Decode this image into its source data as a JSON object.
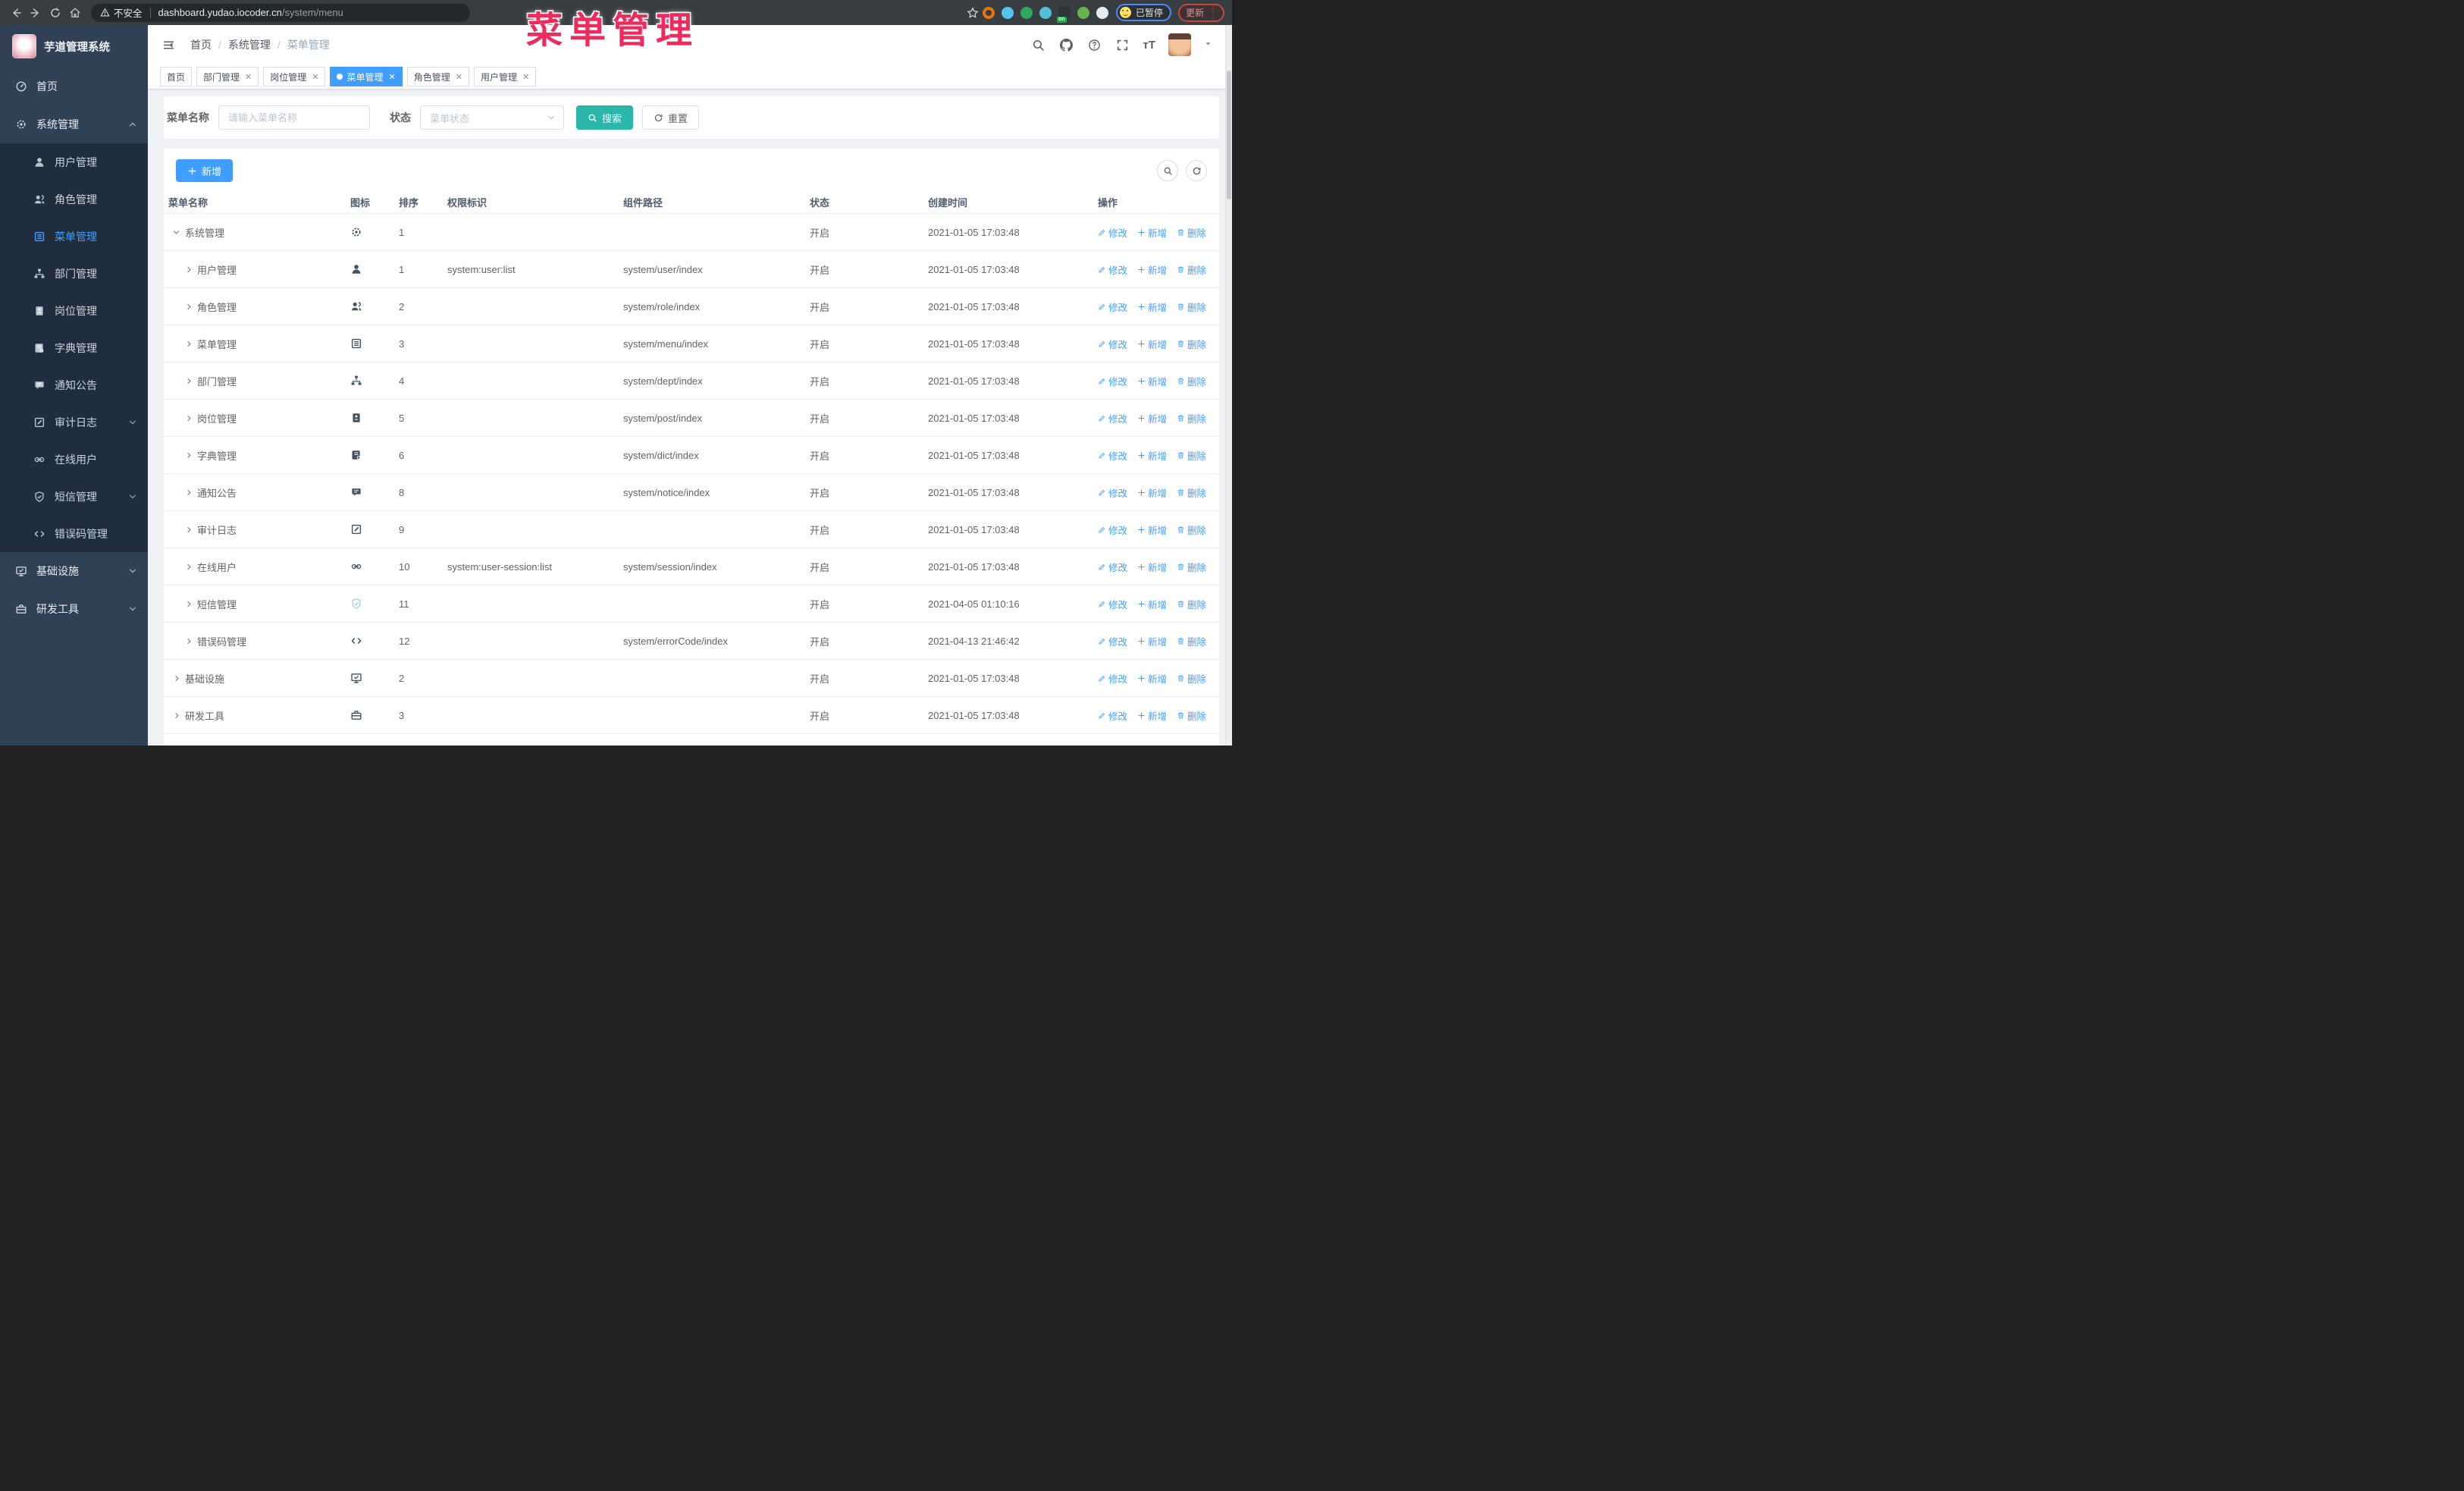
{
  "annotation": {
    "text": "菜单管理",
    "color": "#ee2b5d"
  },
  "browser": {
    "security_label": "不安全",
    "url_host": "dashboard.yudao.iocoder.cn",
    "url_path": "/system/menu",
    "paused_label": "已暂停",
    "update_label": "更新",
    "extension_icons": [
      {
        "name": "extension-icon-orange-ring",
        "color": "#e8710a",
        "style": "ring"
      },
      {
        "name": "extension-icon-blue-gem",
        "color": "#58c1f0",
        "style": "dot"
      },
      {
        "name": "extension-icon-green-check",
        "color": "#2fa75f",
        "style": "dot"
      },
      {
        "name": "extension-icon-teal-columns",
        "color": "#55bdd6",
        "style": "dot"
      },
      {
        "name": "extension-icon-dark-switch",
        "color": "#2f3438",
        "style": "square",
        "badge": "on"
      },
      {
        "name": "extension-icon-green-plant",
        "color": "#69b34b",
        "style": "dot"
      },
      {
        "name": "puzzle-icon",
        "color": "#e9eaed",
        "style": "dot"
      }
    ]
  },
  "sidebar": {
    "logo_title": "芋道管理系统",
    "items": [
      {
        "label": "首页",
        "icon": "dashboard-icon"
      },
      {
        "label": "系统管理",
        "icon": "gear-icon",
        "chevron": "up",
        "open": true,
        "children": [
          {
            "label": "用户管理",
            "icon": "user-icon"
          },
          {
            "label": "角色管理",
            "icon": "users-icon"
          },
          {
            "label": "菜单管理",
            "icon": "menu-icon",
            "active": true
          },
          {
            "label": "部门管理",
            "icon": "tree-icon"
          },
          {
            "label": "岗位管理",
            "icon": "badge-icon"
          },
          {
            "label": "字典管理",
            "icon": "book-icon"
          },
          {
            "label": "通知公告",
            "icon": "message-icon"
          },
          {
            "label": "审计日志",
            "icon": "edit-icon",
            "chevron": "down"
          },
          {
            "label": "在线用户",
            "icon": "link-icon"
          },
          {
            "label": "短信管理",
            "icon": "shield-icon",
            "chevron": "down"
          },
          {
            "label": "错误码管理",
            "icon": "code-icon"
          }
        ]
      },
      {
        "label": "基础设施",
        "icon": "monitor-icon",
        "chevron": "down"
      },
      {
        "label": "研发工具",
        "icon": "toolbox-icon",
        "chevron": "down"
      }
    ]
  },
  "header": {
    "breadcrumb": [
      "首页",
      "系统管理",
      "菜单管理"
    ]
  },
  "tabs": [
    {
      "label": "首页",
      "closable": false,
      "active": false
    },
    {
      "label": "部门管理",
      "closable": true,
      "active": false
    },
    {
      "label": "岗位管理",
      "closable": true,
      "active": false
    },
    {
      "label": "菜单管理",
      "closable": true,
      "active": true
    },
    {
      "label": "角色管理",
      "closable": true,
      "active": false
    },
    {
      "label": "用户管理",
      "closable": true,
      "active": false
    }
  ],
  "filter": {
    "name_label": "菜单名称",
    "name_placeholder": "请输入菜单名称",
    "name_value": "",
    "status_label": "状态",
    "status_placeholder": "菜单状态",
    "search_label": "搜索",
    "reset_label": "重置"
  },
  "toolbar": {
    "add_label": "新增"
  },
  "table": {
    "columns": [
      "菜单名称",
      "图标",
      "排序",
      "权限标识",
      "组件路径",
      "状态",
      "创建时间",
      "操作"
    ],
    "action_labels": {
      "edit": "修改",
      "add": "新增",
      "delete": "删除"
    },
    "rows": [
      {
        "name": "系统管理",
        "icon": "gear-icon",
        "level": 0,
        "expanded": true,
        "sort": "1",
        "perm": "",
        "path": "",
        "status": "开启",
        "time": "2021-01-05 17:03:48"
      },
      {
        "name": "用户管理",
        "icon": "user-icon",
        "level": 1,
        "expanded": false,
        "sort": "1",
        "perm": "system:user:list",
        "path": "system/user/index",
        "status": "开启",
        "time": "2021-01-05 17:03:48"
      },
      {
        "name": "角色管理",
        "icon": "users-icon",
        "level": 1,
        "expanded": false,
        "sort": "2",
        "perm": "",
        "path": "system/role/index",
        "status": "开启",
        "time": "2021-01-05 17:03:48"
      },
      {
        "name": "菜单管理",
        "icon": "menu-icon",
        "level": 1,
        "expanded": false,
        "sort": "3",
        "perm": "",
        "path": "system/menu/index",
        "status": "开启",
        "time": "2021-01-05 17:03:48"
      },
      {
        "name": "部门管理",
        "icon": "tree-icon",
        "level": 1,
        "expanded": false,
        "sort": "4",
        "perm": "",
        "path": "system/dept/index",
        "status": "开启",
        "time": "2021-01-05 17:03:48"
      },
      {
        "name": "岗位管理",
        "icon": "badge-icon",
        "level": 1,
        "expanded": false,
        "sort": "5",
        "perm": "",
        "path": "system/post/index",
        "status": "开启",
        "time": "2021-01-05 17:03:48"
      },
      {
        "name": "字典管理",
        "icon": "book-icon",
        "level": 1,
        "expanded": false,
        "sort": "6",
        "perm": "",
        "path": "system/dict/index",
        "status": "开启",
        "time": "2021-01-05 17:03:48"
      },
      {
        "name": "通知公告",
        "icon": "message-icon",
        "level": 1,
        "expanded": false,
        "sort": "8",
        "perm": "",
        "path": "system/notice/index",
        "status": "开启",
        "time": "2021-01-05 17:03:48"
      },
      {
        "name": "审计日志",
        "icon": "edit-icon",
        "level": 1,
        "expanded": false,
        "sort": "9",
        "perm": "",
        "path": "",
        "status": "开启",
        "time": "2021-01-05 17:03:48"
      },
      {
        "name": "在线用户",
        "icon": "link-icon",
        "level": 1,
        "expanded": false,
        "sort": "10",
        "perm": "system:user-session:list",
        "path": "system/session/index",
        "status": "开启",
        "time": "2021-01-05 17:03:48"
      },
      {
        "name": "短信管理",
        "icon": "shield-icon",
        "level": 1,
        "expanded": false,
        "sort": "11",
        "perm": "",
        "path": "",
        "status": "开启",
        "time": "2021-04-05 01:10:16"
      },
      {
        "name": "错误码管理",
        "icon": "code-icon",
        "level": 1,
        "expanded": false,
        "sort": "12",
        "perm": "",
        "path": "system/errorCode/index",
        "status": "开启",
        "time": "2021-04-13 21:46:42"
      },
      {
        "name": "基础设施",
        "icon": "monitor-icon",
        "level": 0,
        "expanded": false,
        "sort": "2",
        "perm": "",
        "path": "",
        "status": "开启",
        "time": "2021-01-05 17:03:48"
      },
      {
        "name": "研发工具",
        "icon": "toolbox-icon",
        "level": 0,
        "expanded": false,
        "sort": "3",
        "perm": "",
        "path": "",
        "status": "开启",
        "time": "2021-01-05 17:03:48"
      }
    ]
  }
}
